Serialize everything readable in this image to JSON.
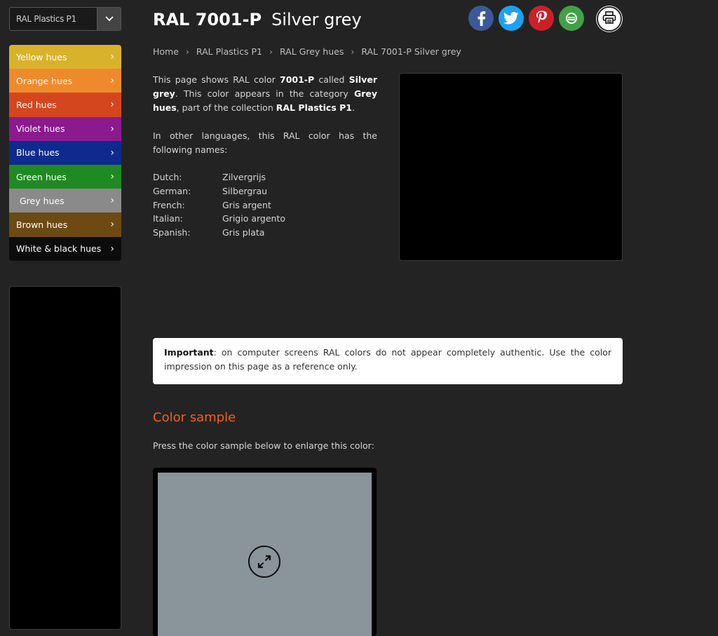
{
  "collection_select": {
    "label": "RAL Plastics P1"
  },
  "sidebar": {
    "hues": [
      {
        "label": "Yellow hues",
        "color": "#d9b22b"
      },
      {
        "label": "Orange hues",
        "color": "#ef8a2c"
      },
      {
        "label": "Red hues",
        "color": "#d4461e"
      },
      {
        "label": "Violet hues",
        "color": "#8a1a8e"
      },
      {
        "label": "Blue hues",
        "color": "#0f2a8e"
      },
      {
        "label": "Green hues",
        "color": "#208a22"
      },
      {
        "label": "Grey hues",
        "color": "#8a8a8a"
      },
      {
        "label": "Brown hues",
        "color": "#6c4a12"
      },
      {
        "label": "White & black hues",
        "color": "#0c0c0c"
      }
    ]
  },
  "header": {
    "code": "RAL 7001-P",
    "name": "Silver grey"
  },
  "social": [
    {
      "icon": "facebook-icon",
      "color": "#3b5998"
    },
    {
      "icon": "twitter-icon",
      "color": "#1da1f2"
    },
    {
      "icon": "pinterest-icon",
      "color": "#cb2027"
    },
    {
      "icon": "share-icon",
      "color": "#43a047"
    }
  ],
  "breadcrumb": [
    "Home",
    "RAL Plastics P1",
    "RAL Grey hues",
    "RAL 7001-P Silver grey"
  ],
  "intro": {
    "t1": "This page shows RAL color ",
    "code": "7001-P",
    "t2": " called ",
    "name": "Silver grey",
    "t3": ". This color appears in the category ",
    "category": "Grey hues",
    "t4": ", part of the collection ",
    "collection": "RAL Plastics P1",
    "t5": ".",
    "langs_intro": "In other languages, this RAL color has the following names:"
  },
  "languages": [
    {
      "language": "Dutch:",
      "name": "Zilvergrijs"
    },
    {
      "language": "German:",
      "name": "Silbergrau"
    },
    {
      "language": "French:",
      "name": "Gris argent"
    },
    {
      "language": "Italian:",
      "name": "Grigio argento"
    },
    {
      "language": "Spanish:",
      "name": "Gris plata"
    }
  ],
  "notice": {
    "bold": "Important",
    "text": ": on computer screens RAL colors do not appear completely authentic. Use the color impression on this page as a reference only."
  },
  "color_sample": {
    "title": "Color sample",
    "instruction": "Press the color sample below to enlarge this color:",
    "color": "#8a959b"
  }
}
